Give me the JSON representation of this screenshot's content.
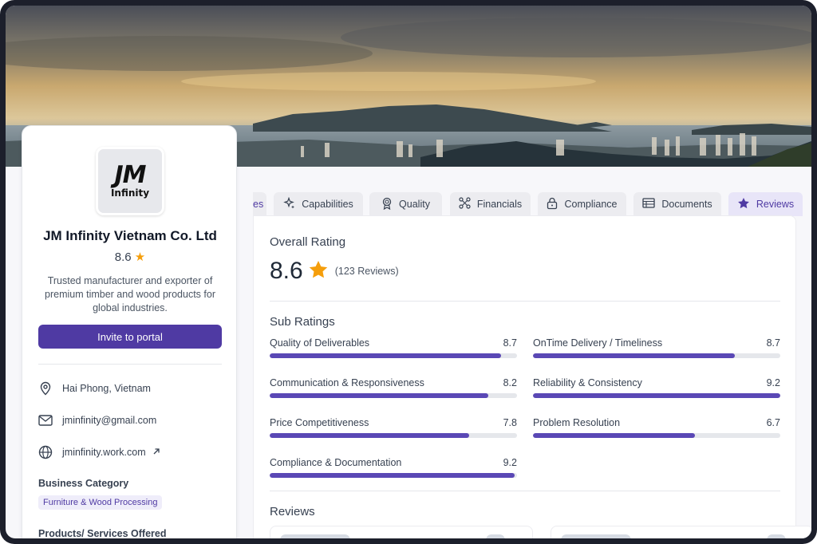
{
  "profile": {
    "logo_main": "JM",
    "logo_sub": "Infinity",
    "company_name": "JM Infinity Vietnam Co. Ltd",
    "rating": "8.6",
    "description": "Trusted manufacturer and exporter of premium timber and wood products for global industries.",
    "invite_label": "Invite to portal",
    "location": "Hai Phong, Vietnam",
    "email": "jminfinity@gmail.com",
    "website": "jminfinity.work.com",
    "business_category_label": "Business Category",
    "business_category_tag": "Furniture & Wood Processing",
    "products_label": "Products/ Services Offered"
  },
  "tabs": [
    {
      "label": "es",
      "icon": "none"
    },
    {
      "label": "Capabilities",
      "icon": "sparkle-icon"
    },
    {
      "label": "Quality",
      "icon": "award-icon"
    },
    {
      "label": "Financials",
      "icon": "network-icon"
    },
    {
      "label": "Compliance",
      "icon": "lock-icon"
    },
    {
      "label": "Documents",
      "icon": "table-icon"
    },
    {
      "label": "Reviews",
      "icon": "star-icon",
      "active": true
    }
  ],
  "overall": {
    "title": "Overall Rating",
    "value": "8.6",
    "count": "(123 Reviews)"
  },
  "sub_ratings": {
    "title": "Sub Ratings",
    "items": [
      {
        "label": "Quality of Deliverables",
        "value": "8.7",
        "fraction": 0.935
      },
      {
        "label": "OnTime Delivery / Timeliness",
        "value": "8.7",
        "fraction": 0.815
      },
      {
        "label": "Communication & Responsiveness",
        "value": "8.2",
        "fraction": 0.885
      },
      {
        "label": "Reliability & Consistency",
        "value": "9.2",
        "fraction": 1.0
      },
      {
        "label": "Price Competitiveness",
        "value": "7.8",
        "fraction": 0.805
      },
      {
        "label": "Problem Resolution",
        "value": "6.7",
        "fraction": 0.655
      },
      {
        "label": "Compliance & Documentation",
        "value": "9.2",
        "fraction": 0.99
      }
    ]
  },
  "reviews": {
    "title": "Reviews"
  },
  "colors": {
    "accent": "#4f3aa3",
    "bar": "#5a48b5",
    "star": "#f59e0b"
  }
}
